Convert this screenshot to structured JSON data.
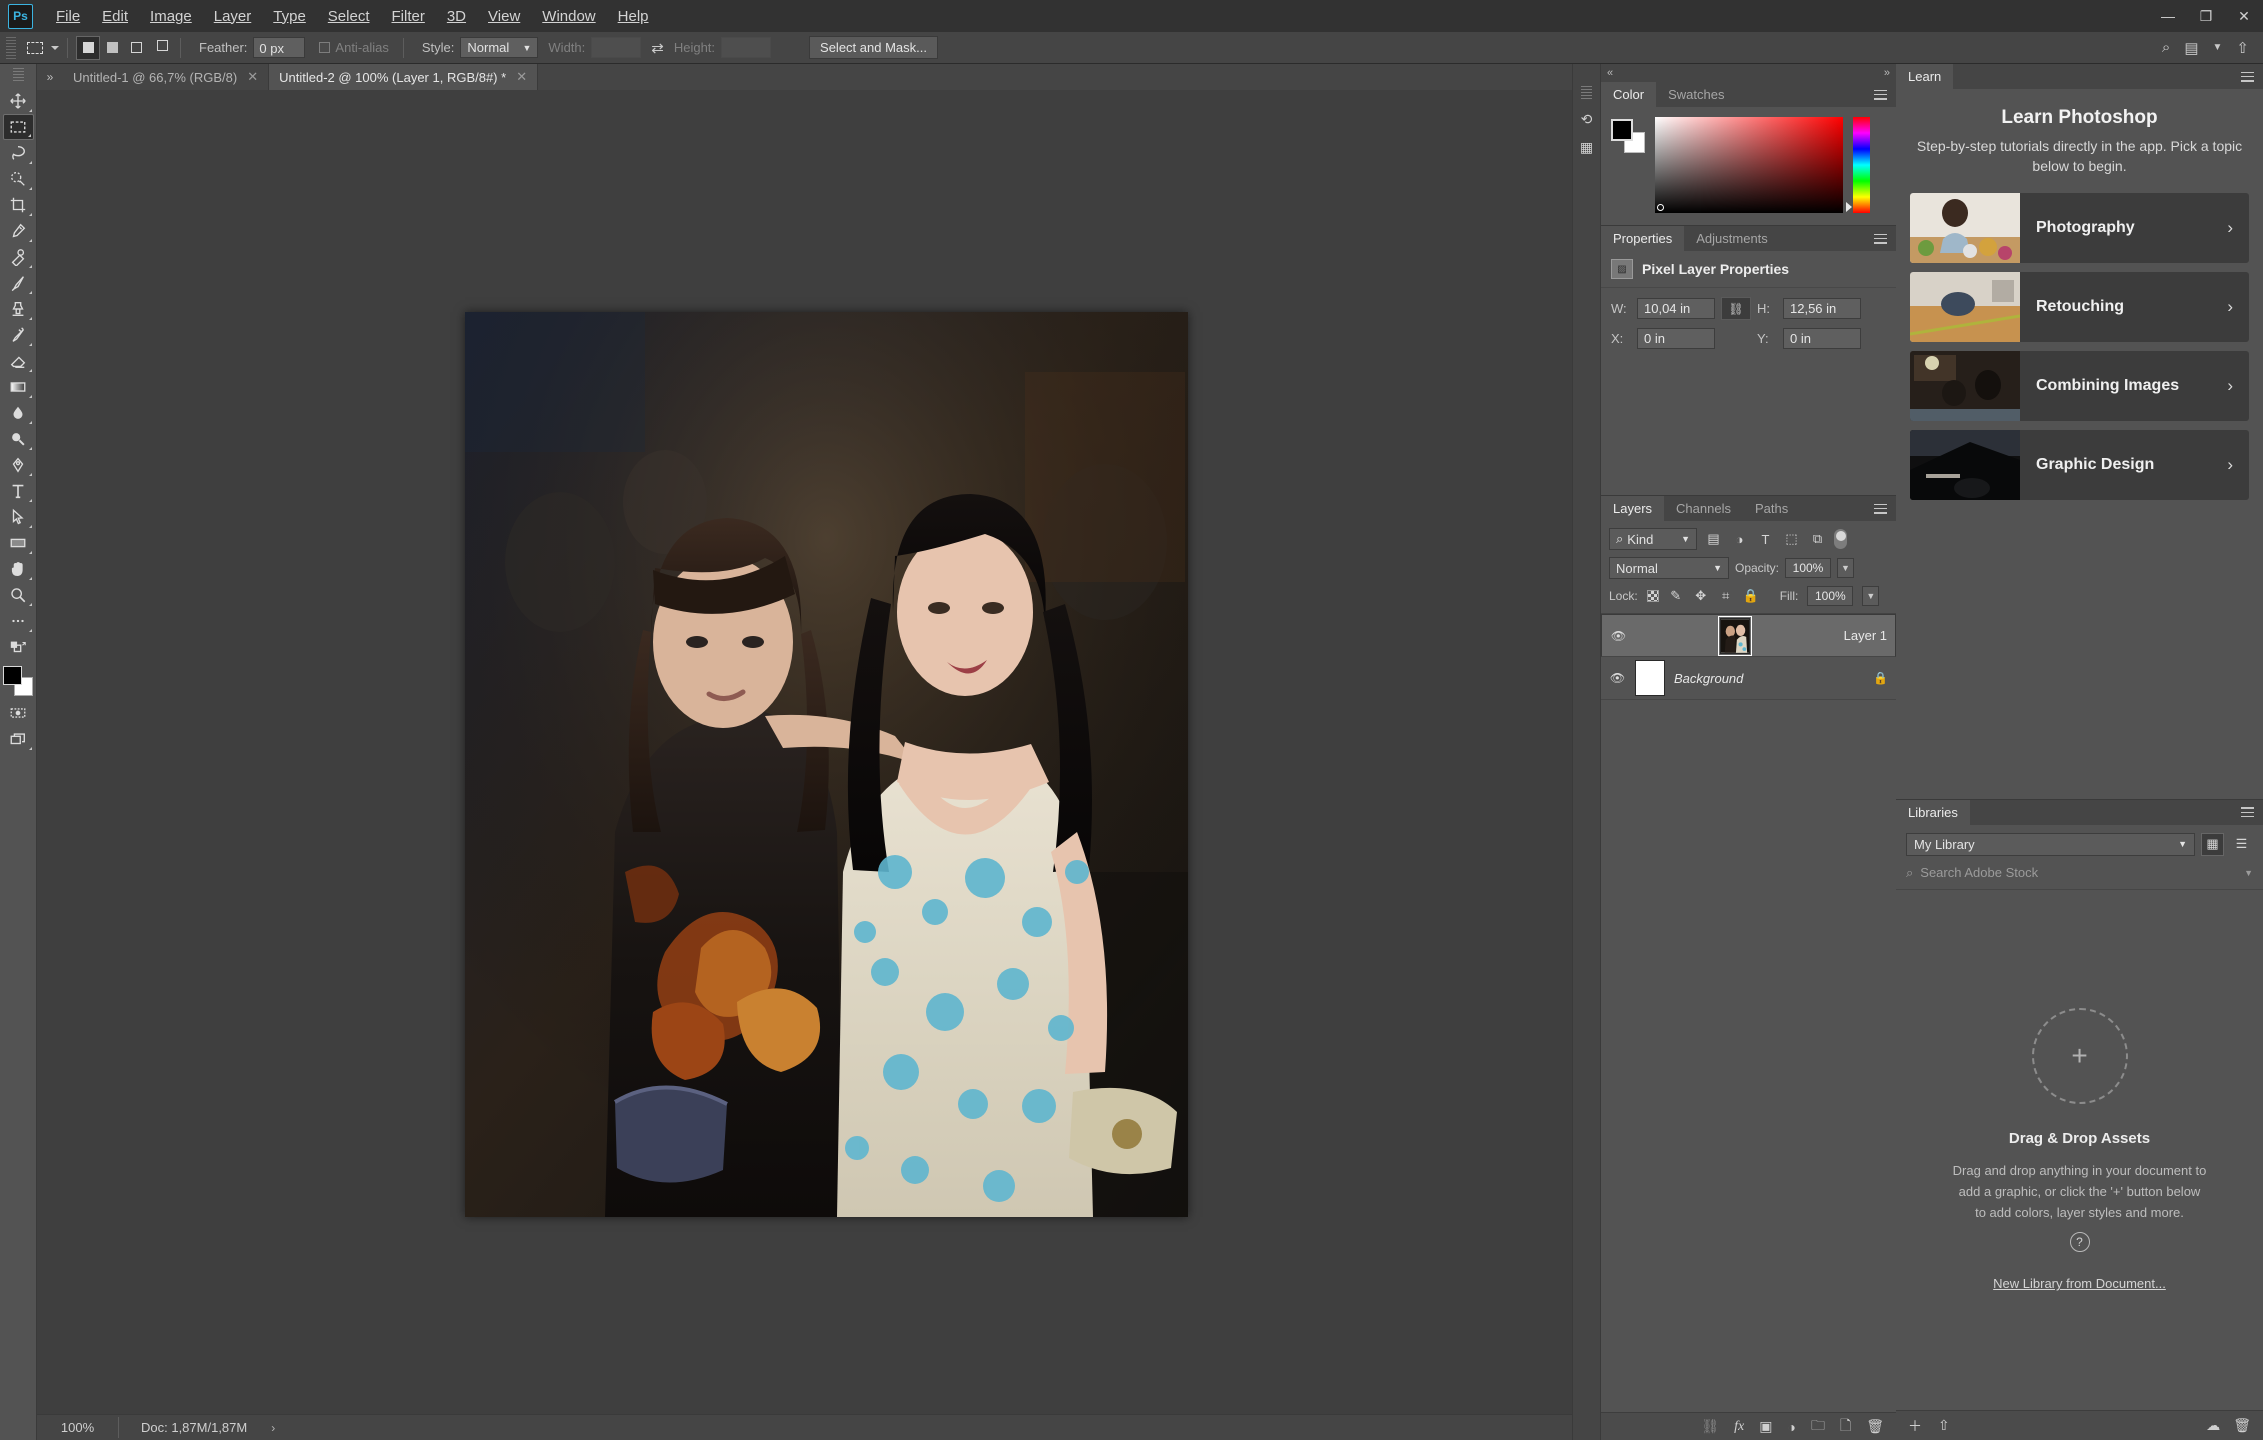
{
  "app": {
    "logo": "Ps",
    "title": "Adobe Photoshop"
  },
  "menubar": {
    "items": [
      "File",
      "Edit",
      "Image",
      "Layer",
      "Type",
      "Select",
      "Filter",
      "3D",
      "View",
      "Window",
      "Help"
    ],
    "window_controls": {
      "minimize": "—",
      "restore": "❐",
      "close": "✕"
    }
  },
  "options_bar": {
    "tool_icon": "rectangular-marquee-icon",
    "selection_modes": [
      "new-selection",
      "add-to-selection",
      "subtract-from-selection",
      "intersect-with-selection"
    ],
    "feather_label": "Feather:",
    "feather_value": "0 px",
    "antialias_label": "Anti-alias",
    "antialias_checked": false,
    "style_label": "Style:",
    "style_value": "Normal",
    "width_label": "Width:",
    "width_value": "",
    "swap_icon": "swap-width-height-icon",
    "height_label": "Height:",
    "height_value": "",
    "select_and_mask": "Select and Mask...",
    "right_icons": [
      "search-icon",
      "workspace-icon",
      "chevron-down-icon",
      "share-icon"
    ]
  },
  "toolbox": {
    "tools": [
      {
        "name": "move-tool",
        "glyph": "✥",
        "active": false
      },
      {
        "name": "rectangular-marquee-tool",
        "glyph": "▭",
        "active": true
      },
      {
        "name": "lasso-tool",
        "glyph": "◯",
        "active": false
      },
      {
        "name": "quick-selection-tool",
        "glyph": "❋",
        "active": false
      },
      {
        "name": "crop-tool",
        "glyph": "⌗",
        "active": false
      },
      {
        "name": "eyedropper-tool",
        "glyph": "⚲",
        "active": false
      },
      {
        "name": "spot-healing-brush-tool",
        "glyph": "✚",
        "active": false
      },
      {
        "name": "brush-tool",
        "glyph": "✎",
        "active": false
      },
      {
        "name": "clone-stamp-tool",
        "glyph": "⎙",
        "active": false
      },
      {
        "name": "history-brush-tool",
        "glyph": "❧",
        "active": false
      },
      {
        "name": "eraser-tool",
        "glyph": "▰",
        "active": false
      },
      {
        "name": "gradient-tool",
        "glyph": "▬",
        "active": false
      },
      {
        "name": "blur-tool",
        "glyph": "💧",
        "active": false
      },
      {
        "name": "dodge-tool",
        "glyph": "◍",
        "active": false
      },
      {
        "name": "pen-tool",
        "glyph": "✒",
        "active": false
      },
      {
        "name": "horizontal-type-tool",
        "glyph": "T",
        "active": false
      },
      {
        "name": "path-selection-tool",
        "glyph": "➤",
        "active": false
      },
      {
        "name": "rectangle-tool",
        "glyph": "▭",
        "active": false
      },
      {
        "name": "hand-tool",
        "glyph": "✋",
        "active": false
      },
      {
        "name": "zoom-tool",
        "glyph": "🔍",
        "active": false
      },
      {
        "name": "edit-toolbar-tool",
        "glyph": "•••",
        "active": false
      }
    ],
    "foreground_color": "#000000",
    "background_color": "#ffffff",
    "quick-mask": "quick-mask-mode",
    "screen-mode": "change-screen-mode"
  },
  "document_tabs": [
    {
      "label": "Untitled-1 @ 66,7% (RGB/8)",
      "active": false,
      "close": "✕"
    },
    {
      "label": "Untitled-2 @ 100% (Layer 1, RGB/8#) *",
      "active": true,
      "close": "✕"
    }
  ],
  "status_bar": {
    "zoom": "100%",
    "doc_info": "Doc: 1,87M/1,87M",
    "expand_arrow": "›"
  },
  "color_panel": {
    "tabs": [
      {
        "label": "Color",
        "active": true
      },
      {
        "label": "Swatches",
        "active": false
      }
    ],
    "foreground": "#000000",
    "background": "#ffffff",
    "hue_accent": "#ff0000",
    "menu_icon": "panel-menu-icon"
  },
  "properties_panel": {
    "tabs": [
      {
        "label": "Properties",
        "active": true
      },
      {
        "label": "Adjustments",
        "active": false
      }
    ],
    "header": "Pixel Layer Properties",
    "header_icon": "pixel-layer-icon",
    "fields": [
      {
        "label": "W:",
        "value": "10,04 in"
      },
      {
        "label": "H:",
        "value": "12,56 in"
      },
      {
        "label": "X:",
        "value": "0 in"
      },
      {
        "label": "Y:",
        "value": "0 in"
      }
    ],
    "link_icon": "link-constrain-icon",
    "menu_icon": "panel-menu-icon"
  },
  "layers_panel": {
    "tabs": [
      {
        "label": "Layers",
        "active": true
      },
      {
        "label": "Channels",
        "active": false
      },
      {
        "label": "Paths",
        "active": false
      }
    ],
    "filter_kind": "Kind",
    "filter_icons": [
      "pixel-filter-icon",
      "adjustment-filter-icon",
      "type-filter-icon",
      "shape-filter-icon",
      "smart-object-filter-icon"
    ],
    "filter_toggle": "filter-enable-toggle",
    "blend_mode": "Normal",
    "opacity_label": "Opacity:",
    "opacity_value": "100%",
    "lock_label": "Lock:",
    "lock_icons": [
      "lock-transparent-pixels-icon",
      "lock-image-pixels-icon",
      "lock-position-icon",
      "lock-artboard-nesting-icon",
      "lock-all-icon"
    ],
    "fill_label": "Fill:",
    "fill_value": "100%",
    "layers": [
      {
        "name": "Layer 1",
        "visible": true,
        "selected": true,
        "locked": false,
        "italic": false,
        "thumb": "photo"
      },
      {
        "name": "Background",
        "visible": true,
        "selected": false,
        "locked": true,
        "italic": true,
        "thumb": "white"
      }
    ],
    "footer_icons": [
      "link-layers-icon",
      "add-layer-style-icon",
      "add-layer-mask-icon",
      "new-fill-adjustment-icon",
      "new-group-icon",
      "new-layer-icon",
      "delete-layer-icon"
    ],
    "menu_icon": "panel-menu-icon"
  },
  "learn_panel": {
    "tab": "Learn",
    "title": "Learn Photoshop",
    "subtitle": "Step-by-step tutorials directly in the app. Pick a topic below to begin.",
    "cards": [
      {
        "label": "Photography",
        "chevron": "›"
      },
      {
        "label": "Retouching",
        "chevron": "›"
      },
      {
        "label": "Combining Images",
        "chevron": "›"
      },
      {
        "label": "Graphic Design",
        "chevron": "›"
      }
    ],
    "menu_icon": "panel-menu-icon"
  },
  "libraries_panel": {
    "tab": "Libraries",
    "library_select": "My Library",
    "view_grid": "grid-view-icon",
    "view_list": "list-view-icon",
    "search_placeholder": "Search Adobe Stock",
    "dropzone_title": "Drag & Drop Assets",
    "dropzone_body_lines": [
      "Drag and drop anything in your document to",
      "add a graphic, or click the '+' button below",
      "to add colors, layer styles and more."
    ],
    "help_icon": "help-icon",
    "new_library_link": "New Library from Document...",
    "footer_icons": [
      "add-content-icon",
      "upload-icon",
      "sync-icon",
      "delete-icon"
    ],
    "menu_icon": "panel-menu-icon"
  },
  "icon_dock": {
    "items": [
      "collapse-panels-icon",
      "history-icon",
      "actions-icon"
    ]
  },
  "colors": {
    "app_bg": "#535353",
    "menu_bg": "#323232",
    "panel_bg": "#535353",
    "panel_tab_bg": "#454545",
    "canvas_bg": "#3f3f3f",
    "accent": "#3bb3e0",
    "field_bg": "#5f5f5f",
    "selected_row": "#6a6a6a"
  }
}
